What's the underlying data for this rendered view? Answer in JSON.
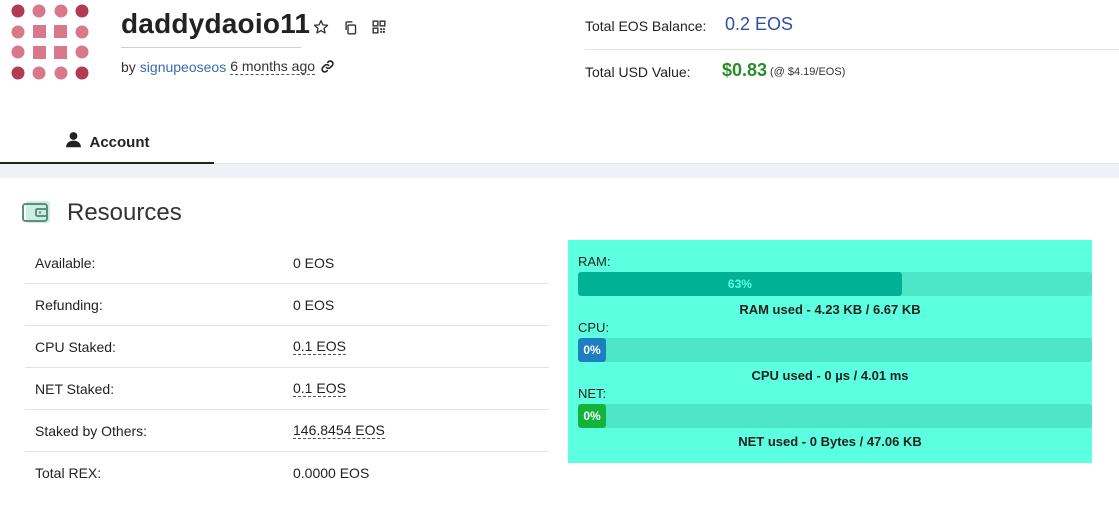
{
  "account": {
    "name": "daddydaoio11",
    "by_prefix": "by",
    "creator": "signupeoseos",
    "age": "6 months ago"
  },
  "balance": {
    "eos_label": "Total EOS Balance:",
    "eos_value": "0.2 EOS",
    "usd_label": "Total USD Value:",
    "usd_value": "$0.83",
    "usd_rate": "(@ $4.19/EOS)"
  },
  "tabs": [
    {
      "label": "Account",
      "icon": "user-icon",
      "active": true
    }
  ],
  "resources": {
    "title": "Resources",
    "rows": [
      {
        "label": "Available:",
        "value": "0 EOS"
      },
      {
        "label": "Refunding:",
        "value": "0 EOS"
      },
      {
        "label": "CPU Staked:",
        "value": "0.1 EOS"
      },
      {
        "label": "NET Staked:",
        "value": "0.1 EOS"
      },
      {
        "label": "Staked by Others:",
        "value": "146.8454 EOS"
      },
      {
        "label": "Total REX:",
        "value": "0.0000 EOS"
      }
    ]
  },
  "usage": {
    "ram": {
      "label": "RAM:",
      "percent_text": "63%",
      "percent": 63,
      "caption": "RAM used - 4.23 KB / 6.67 KB"
    },
    "cpu": {
      "label": "CPU:",
      "percent_text": "0%",
      "percent": 0,
      "caption": "CPU used - 0 µs / 4.01 ms"
    },
    "net": {
      "label": "NET:",
      "percent_text": "0%",
      "percent": 0,
      "caption": "NET used - 0 Bytes / 47.06 KB"
    }
  },
  "colors": {
    "panel_bg": "#5cffe0",
    "ram_fill": "#00b195",
    "cpu_fill": "#1d7fc0",
    "net_fill": "#12b53a",
    "eos_value": "#2e4fa3",
    "usd_value": "#2a8c2a",
    "avatar_dark": "#b23a52",
    "avatar_light": "#d9788a"
  }
}
